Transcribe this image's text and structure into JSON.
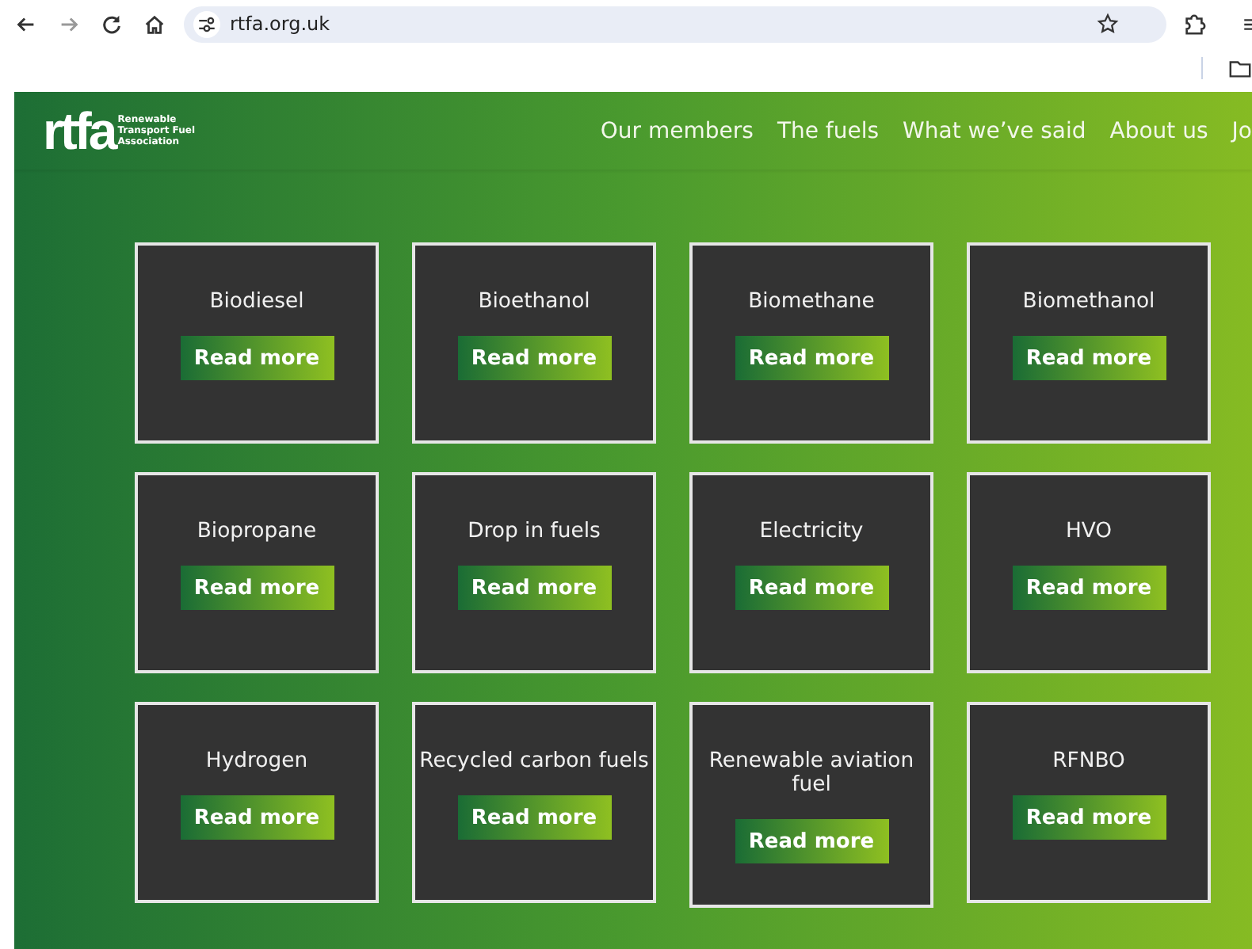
{
  "browser": {
    "url": "rtfa.org.uk"
  },
  "header": {
    "logo_mark": "rtfa",
    "logo_caption": [
      "Renewable",
      "Transport Fuel",
      "Association"
    ],
    "nav": [
      {
        "label": "Our members"
      },
      {
        "label": "The fuels"
      },
      {
        "label": "What we’ve said"
      },
      {
        "label": "About us"
      },
      {
        "label": "Jo"
      }
    ]
  },
  "cards": [
    {
      "title": "Biodiesel",
      "button": "Read more"
    },
    {
      "title": "Bioethanol",
      "button": "Read more"
    },
    {
      "title": "Biomethane",
      "button": "Read more"
    },
    {
      "title": "Biomethanol",
      "button": "Read more"
    },
    {
      "title": "Biopropane",
      "button": "Read more"
    },
    {
      "title": "Drop in fuels",
      "button": "Read more"
    },
    {
      "title": "Electricity",
      "button": "Read more"
    },
    {
      "title": "HVO",
      "button": "Read more"
    },
    {
      "title": "Hydrogen",
      "button": "Read more"
    },
    {
      "title": "Recycled carbon fuels",
      "button": "Read more"
    },
    {
      "title": "Renewable aviation fuel",
      "button": "Read more"
    },
    {
      "title": "RFNBO",
      "button": "Read more"
    }
  ]
}
